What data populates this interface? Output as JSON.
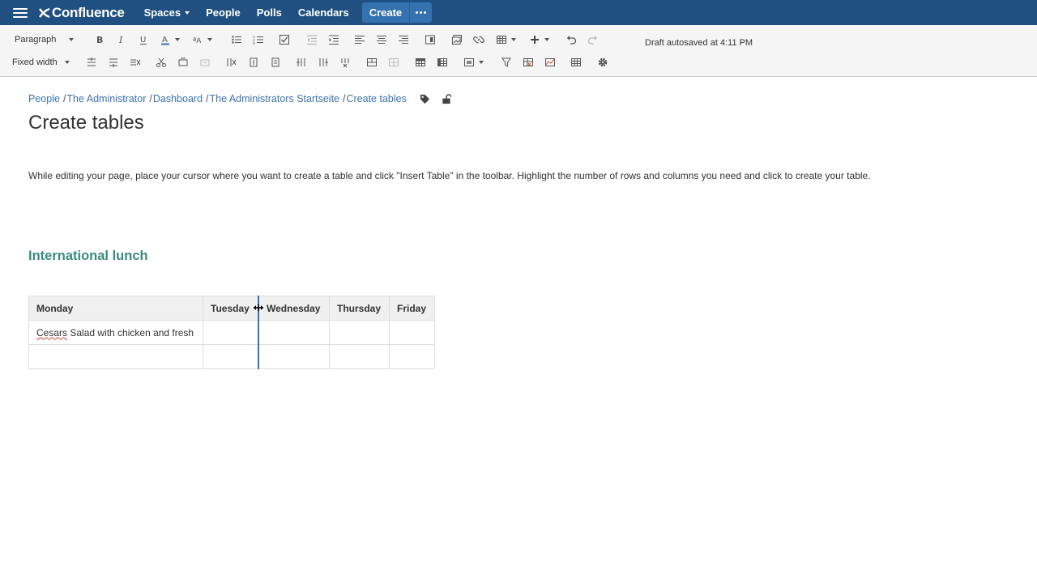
{
  "nav": {
    "logo": "Confluence",
    "spaces": "Spaces",
    "people": "People",
    "polls": "Polls",
    "calendars": "Calendars",
    "create": "Create"
  },
  "toolbar": {
    "paragraph": "Paragraph",
    "fixed_width": "Fixed width",
    "autosave": "Draft autosaved at 4:11 PM"
  },
  "breadcrumb": {
    "items": [
      "People",
      "The Administrator",
      "Dashboard",
      "The Administrators Startseite",
      "Create tables"
    ],
    "separator": "/"
  },
  "page": {
    "title": "Create tables",
    "paragraph": "While editing your page, place your cursor where you want to create a table and click \"Insert Table\" in the toolbar. Highlight the number of rows and columns you need and click to create your table.",
    "heading": "International lunch"
  },
  "table": {
    "headers": [
      "Monday",
      "Tuesday",
      "Wednesday",
      "Thursday",
      "Friday"
    ],
    "rows": [
      [
        "Cesars Salad with chicken and fresh",
        "",
        "",
        "",
        ""
      ],
      [
        "",
        "",
        "",
        "",
        ""
      ]
    ]
  },
  "colors": {
    "nav_bg": "#205081",
    "create_bg": "#3572b0",
    "link": "#3b73af",
    "heading": "#3b8a7f"
  }
}
